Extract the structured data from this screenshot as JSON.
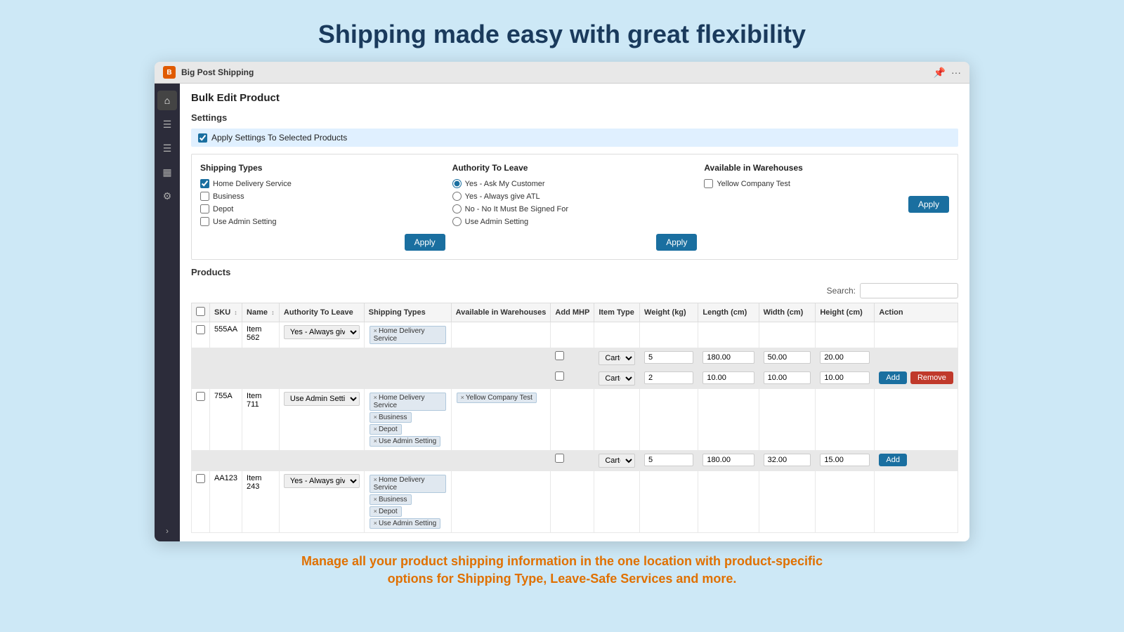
{
  "page": {
    "main_title": "Shipping made easy with great flexibility",
    "footer_text": "Manage all your product shipping information in the one location with product-specific options for Shipping Type, Leave-Safe Services and more."
  },
  "titlebar": {
    "logo_text": "B",
    "app_name": "Big Post Shipping"
  },
  "sidebar": {
    "icons": [
      "home",
      "list",
      "list2",
      "box",
      "gear"
    ],
    "expand_label": ">"
  },
  "main": {
    "bulk_edit_title": "Bulk Edit Product",
    "settings_label": "Settings",
    "apply_settings_checkbox": "Apply Settings To Selected Products",
    "shipping_types": {
      "title": "Shipping Types",
      "options": [
        {
          "label": "Home Delivery Service",
          "checked": true
        },
        {
          "label": "Business",
          "checked": false
        },
        {
          "label": "Depot",
          "checked": false
        },
        {
          "label": "Use Admin Setting",
          "checked": false
        }
      ],
      "apply_label": "Apply"
    },
    "authority_to_leave": {
      "title": "Authority To Leave",
      "options": [
        {
          "label": "Yes - Ask My Customer",
          "selected": true
        },
        {
          "label": "Yes - Always give ATL",
          "selected": false
        },
        {
          "label": "No - No It Must Be Signed For",
          "selected": false
        },
        {
          "label": "Use Admin Setting",
          "selected": false
        }
      ],
      "apply_label": "Apply"
    },
    "available_in_warehouses": {
      "title": "Available in Warehouses",
      "options": [
        {
          "label": "Yellow Company Test",
          "checked": false
        }
      ],
      "apply_label": "Apply"
    },
    "products": {
      "section_title": "Products",
      "search_label": "Search:",
      "columns": [
        "",
        "SKU",
        "Name",
        "Authority To Leave",
        "Shipping Types",
        "Available in Warehouses",
        "Add MHP",
        "Item Type",
        "Weight (kg)",
        "Length (cm)",
        "Width (cm)",
        "Height (cm)",
        "Action"
      ],
      "rows": [
        {
          "id": "row1",
          "sku": "555AA",
          "name": "Item 562",
          "authority_to_leave": "Yes - Always give ATL",
          "shipping_types": [
            "Home Delivery Service"
          ],
          "warehouses": [],
          "sub_rows": [
            {
              "checkbox": false,
              "item_type": "Cartor",
              "weight": "5",
              "length": "180.00",
              "width": "50.00",
              "height": "20.00",
              "actions": []
            },
            {
              "checkbox": false,
              "item_type": "Cartor",
              "weight": "2",
              "length": "10.00",
              "width": "10.00",
              "height": "10.00",
              "actions": [
                "Add",
                "Remove"
              ]
            }
          ]
        },
        {
          "id": "row2",
          "sku": "755A",
          "name": "Item 711",
          "authority_to_leave": "Use Admin Setting",
          "shipping_types": [
            "Home Delivery Service",
            "Business",
            "Depot",
            "Use Admin Setting"
          ],
          "warehouses": [
            "Yellow Company Test"
          ],
          "sub_rows": [
            {
              "checkbox": false,
              "item_type": "Cartor",
              "weight": "5",
              "length": "180.00",
              "width": "32.00",
              "height": "15.00",
              "actions": [
                "Add"
              ]
            }
          ]
        },
        {
          "id": "row3",
          "sku": "AA123",
          "name": "Item 243",
          "authority_to_leave": "Yes - Always give ATL",
          "shipping_types": [
            "Home Delivery Service",
            "Business",
            "Depot",
            "Use Admin Setting"
          ],
          "warehouses": [],
          "sub_rows": []
        }
      ]
    }
  }
}
